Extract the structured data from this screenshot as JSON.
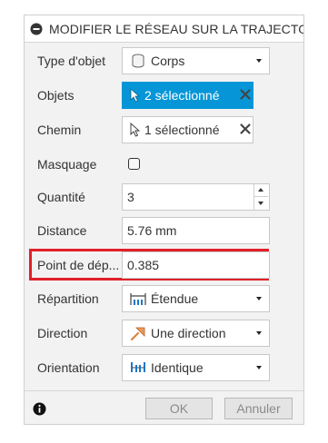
{
  "dialog": {
    "title": "MODIFIER LE RÉSEAU SUR LA TRAJECTOI",
    "object_type": {
      "label": "Type d'objet",
      "value": "Corps",
      "icon": "body-icon"
    },
    "objects": {
      "label": "Objets",
      "value": "2 sélectionné",
      "icon": "cursor-icon",
      "active": true
    },
    "path": {
      "label": "Chemin",
      "value": "1 sélectionné",
      "icon": "cursor-icon",
      "active": false
    },
    "masking": {
      "label": "Masquage",
      "checked": false
    },
    "quantity": {
      "label": "Quantité",
      "value": "3"
    },
    "distance": {
      "label": "Distance",
      "value": "5.76 mm"
    },
    "start_point": {
      "label": "Point de dép...",
      "value": "0.385",
      "highlighted": true,
      "highlight_color": "#e2202a"
    },
    "distribution": {
      "label": "Répartition",
      "value": "Étendue",
      "icon": "extent-icon"
    },
    "direction": {
      "label": "Direction",
      "value": "Une direction",
      "icon": "direction-icon"
    },
    "orientation": {
      "label": "Orientation",
      "value": "Identique",
      "icon": "identical-icon"
    }
  },
  "footer": {
    "ok_label": "OK",
    "cancel_label": "Annuler"
  },
  "colors": {
    "accent": "#0696d7",
    "highlight": "#e2202a"
  }
}
